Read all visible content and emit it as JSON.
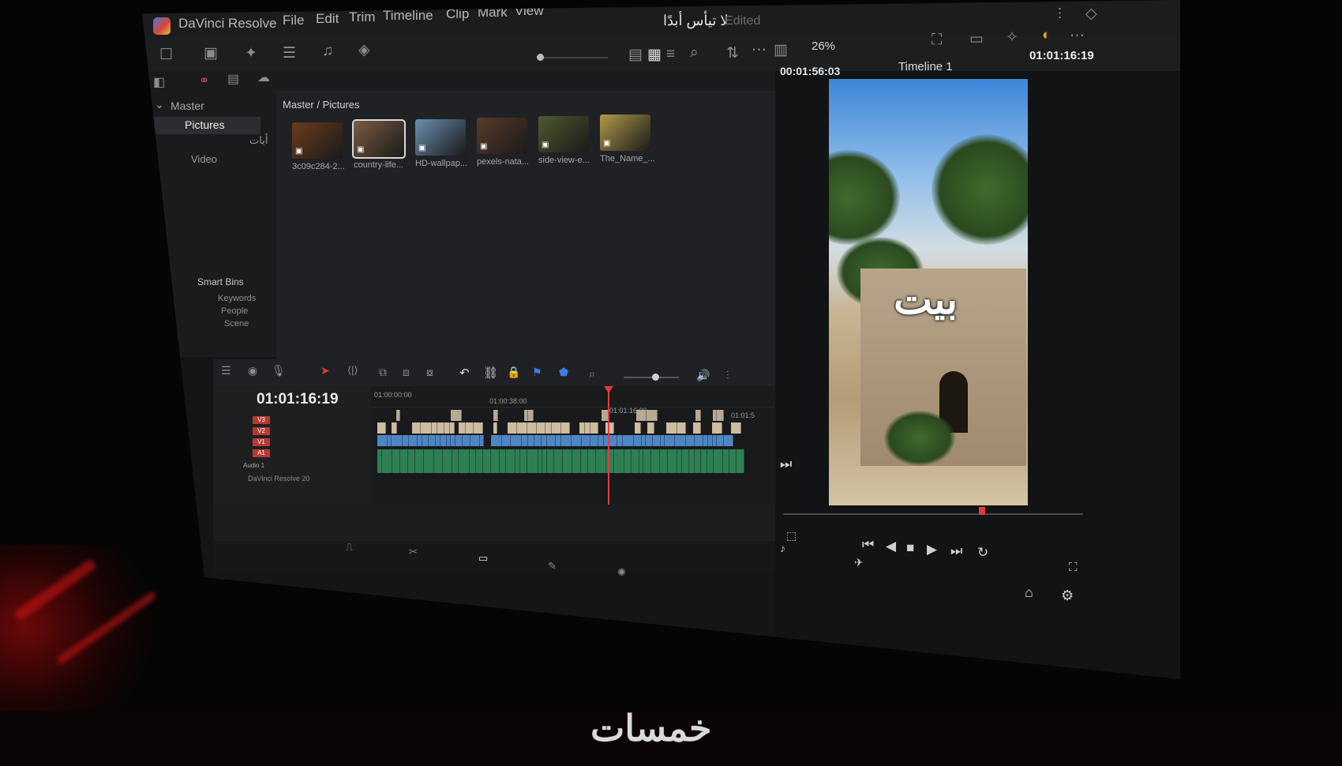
{
  "app": {
    "name": "DaVinci Resolve",
    "project_title": "لا تيأس أبدًا",
    "status": "Edited",
    "menus": [
      "File",
      "Edit",
      "Trim",
      "Timeline",
      "Clip",
      "Mark",
      "View"
    ]
  },
  "toolbar": {
    "zoom": "26%"
  },
  "bins": {
    "root": "Master",
    "items": [
      "Pictures",
      "أبات",
      "Video"
    ],
    "selected": "Pictures",
    "smart_bins_title": "Smart Bins",
    "smart_bins": [
      "Keywords",
      "People",
      "Scene"
    ]
  },
  "media_pool": {
    "breadcrumb": "Master / Pictures",
    "clips": [
      {
        "label": "3c09c284-2...",
        "color": "#6a3b1c"
      },
      {
        "label": "country-life...",
        "color": "#7a5c43",
        "selected": true
      },
      {
        "label": "HD-wallpap...",
        "color": "#6b8fb0"
      },
      {
        "label": "pexels-nata...",
        "color": "#5a3a28"
      },
      {
        "label": "side-view-e...",
        "color": "#4f5a2f"
      },
      {
        "label": "The_Name_...",
        "color": "#b09a4a"
      }
    ]
  },
  "viewer": {
    "source_timecode": "00:01:56:03",
    "timeline_name": "Timeline 1",
    "record_timecode": "01:01:16:19",
    "overlay_text": "بيت"
  },
  "timeline": {
    "current_timecode": "01:01:16:19",
    "tracks": [
      "V3",
      "V2",
      "V1",
      "A1"
    ],
    "audio_label": "Audio 1",
    "ruler": [
      "01:00:00:00",
      "01:00:38:00",
      "01:01:16:00",
      "01:01:5"
    ],
    "version": "DaVinci Resolve 20"
  },
  "watermark": "خمسات"
}
